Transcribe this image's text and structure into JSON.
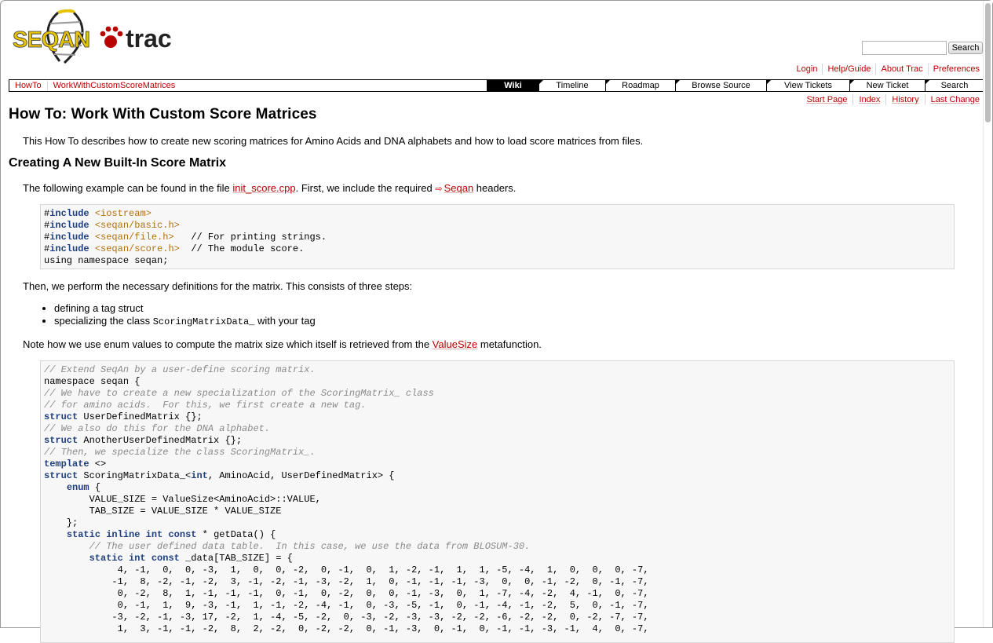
{
  "logo": {
    "text": "SEQAN",
    "trac": "trac"
  },
  "search": {
    "placeholder": "",
    "button_label": "Search"
  },
  "metanav": [
    "Login",
    "Help/Guide",
    "About Trac",
    "Preferences"
  ],
  "context_nav": [
    "HowTo",
    "WorkWithCustomScoreMatrices"
  ],
  "mainnav": [
    {
      "label": "Wiki",
      "active": true
    },
    {
      "label": "Timeline",
      "active": false
    },
    {
      "label": "Roadmap",
      "active": false
    },
    {
      "label": "Browse Source",
      "active": false
    },
    {
      "label": "View Tickets",
      "active": false
    },
    {
      "label": "New Ticket",
      "active": false
    },
    {
      "label": "Search",
      "active": false
    }
  ],
  "ctxnav": [
    "Start Page",
    "Index",
    "History",
    "Last Change"
  ],
  "page": {
    "title": "How To: Work With Custom Score Matrices",
    "intro": "This How To describes how to create new scoring matrices for Amino Acids and DNA alphabets and how to load score matrices from files.",
    "section1_title": "Creating A New Built-In Score Matrix",
    "p1_before": "The following example can be found in the file ",
    "p1_link": "init_score.cpp",
    "p1_middle": ". First, we include the required ",
    "p1_ext_link": "Seqan",
    "p1_after": " headers.",
    "p2": "Then, we perform the necessary definitions for the matrix. This consists of three steps:",
    "bullet1": "defining a tag struct",
    "bullet2_before": "specializing the class ",
    "bullet2_code": "ScoringMatrixData_",
    "bullet2_after": " with your tag",
    "p3_before": "Note how we use enum values to compute the matrix size which itself is retrieved from the ",
    "p3_link": "ValueSize",
    "p3_after": " metafunction."
  },
  "code1": [
    [
      [
        "#",
        ""
      ],
      [
        "include",
        "kw"
      ],
      [
        " ",
        ""
      ],
      [
        "<iostream>",
        "str"
      ]
    ],
    [
      [
        "#",
        ""
      ],
      [
        "include",
        "kw"
      ],
      [
        " ",
        ""
      ],
      [
        "<seqan/basic.h>",
        "str"
      ]
    ],
    [
      [
        "#",
        ""
      ],
      [
        "include",
        "kw"
      ],
      [
        " ",
        ""
      ],
      [
        "<seqan/file.h>",
        "str"
      ],
      [
        "   // For printing strings.",
        ""
      ]
    ],
    [
      [
        "#",
        ""
      ],
      [
        "include",
        "kw"
      ],
      [
        " ",
        ""
      ],
      [
        "<seqan/score.h>",
        "str"
      ],
      [
        "  // The module score.",
        ""
      ]
    ],
    [
      [
        "using namespace seqan;",
        ""
      ]
    ]
  ],
  "code2": [
    [
      [
        "// Extend SeqAn by a user-define scoring matrix.",
        "cm"
      ]
    ],
    [
      [
        "namespace seqan {",
        ""
      ]
    ],
    [
      [
        "// We have to create a new specialization of the ScoringMatrix_ class",
        "cm"
      ]
    ],
    [
      [
        "// for amino acids.  For this, we first create a new tag.",
        "cm"
      ]
    ],
    [
      [
        "struct",
        "kw"
      ],
      [
        " UserDefinedMatrix {};",
        ""
      ]
    ],
    [
      [
        "// We also do this for the DNA alphabet.",
        "cm"
      ]
    ],
    [
      [
        "struct",
        "kw"
      ],
      [
        " AnotherUserDefinedMatrix {};",
        ""
      ]
    ],
    [
      [
        "// Then, we specialize the class ScoringMatrix_.",
        "cm"
      ]
    ],
    [
      [
        "template",
        "kw"
      ],
      [
        " <>",
        ""
      ]
    ],
    [
      [
        "struct",
        "kw"
      ],
      [
        " ScoringMatrixData_<",
        ""
      ],
      [
        "int",
        "kw"
      ],
      [
        ", AminoAcid, UserDefinedMatrix> {",
        ""
      ]
    ],
    [
      [
        "    ",
        ""
      ],
      [
        "enum",
        "kw"
      ],
      [
        " {",
        ""
      ]
    ],
    [
      [
        "        VALUE_SIZE = ValueSize<AminoAcid>::VALUE,",
        ""
      ]
    ],
    [
      [
        "        TAB_SIZE = VALUE_SIZE * VALUE_SIZE",
        ""
      ]
    ],
    [
      [
        "    };",
        ""
      ]
    ],
    [
      [
        "    ",
        ""
      ],
      [
        "static",
        "kw"
      ],
      [
        " ",
        ""
      ],
      [
        "inline",
        "kw"
      ],
      [
        " ",
        ""
      ],
      [
        "int",
        "kw"
      ],
      [
        " ",
        ""
      ],
      [
        "const",
        "kw"
      ],
      [
        " * getData() {",
        ""
      ]
    ],
    [
      [
        "        ",
        ""
      ],
      [
        "// The user defined data table.  In this case, we use the data from BLOSUM-30.",
        "cm"
      ]
    ],
    [
      [
        "        ",
        ""
      ],
      [
        "static",
        "kw"
      ],
      [
        " ",
        ""
      ],
      [
        "int",
        "kw"
      ],
      [
        " ",
        ""
      ],
      [
        "const",
        "kw"
      ],
      [
        " _data[TAB_SIZE] = {",
        ""
      ]
    ],
    [
      [
        "             4, -1,  0,  0, -3,  1,  0,  0, -2,  0, -1,  0,  1, -2, -1,  1,  1, -5, -4,  1,  0,  0,  0, -7,",
        ""
      ]
    ],
    [
      [
        "            -1,  8, -2, -1, -2,  3, -1, -2, -1, -3, -2,  1,  0, -1, -1, -1, -3,  0,  0, -1, -2,  0, -1, -7,",
        ""
      ]
    ],
    [
      [
        "             0, -2,  8,  1, -1, -1, -1,  0, -1,  0, -2,  0,  0, -1, -3,  0,  1, -7, -4, -2,  4, -1,  0, -7,",
        ""
      ]
    ],
    [
      [
        "             0, -1,  1,  9, -3, -1,  1, -1, -2, -4, -1,  0, -3, -5, -1,  0, -1, -4, -1, -2,  5,  0, -1, -7,",
        ""
      ]
    ],
    [
      [
        "            -3, -2, -1, -3, 17, -2,  1, -4, -5, -2,  0, -3, -2, -3, -3, -2, -2, -6, -2, -2,  0, -2, -7, -7,",
        ""
      ]
    ],
    [
      [
        "             1,  3, -1, -1, -2,  8,  2, -2,  0, -2, -2,  0, -1, -3,  0, -1,  0, -1, -1, -3, -1,  4,  0, -7,",
        ""
      ]
    ]
  ]
}
